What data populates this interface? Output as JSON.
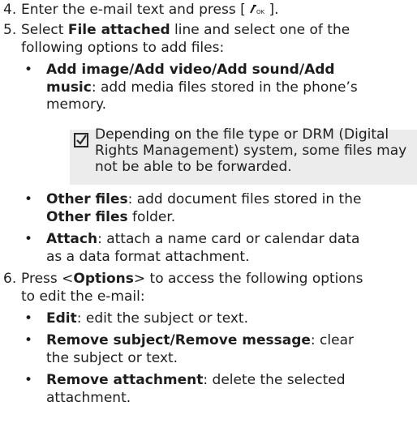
{
  "step4": {
    "num": "4.",
    "text_before": "Enter the e-mail text and press [",
    "text_after": "]."
  },
  "step5": {
    "num": "5.",
    "pre": "Select ",
    "bold": "File attached",
    "post_l1": " line and select one of the",
    "line2": "following options to add files:"
  },
  "b1": {
    "bullet": "•",
    "bold1": "Add image",
    "sep1": "/",
    "bold2": "Add video",
    "sep2": "/",
    "bold3": "Add sound",
    "sep3": "/",
    "bold4": "Add",
    "bold5": "music",
    "rest_l2": ": add media files stored in the phone’s",
    "line3": "memory."
  },
  "note": {
    "icon": "checkbox-note-icon",
    "line1": "Depending on the file type or DRM (Digital",
    "line2": "Rights Management) system, some files may",
    "line3": "not be able to be forwarded."
  },
  "b2": {
    "bullet": "•",
    "bold1": "Other files",
    "rest1": ": add document files stored in the",
    "bold2": "Other files",
    "rest2": " folder."
  },
  "b3": {
    "bullet": "•",
    "bold": "Attach",
    "rest": ": attach a name card or calendar data",
    "line2": "as a data format attachment."
  },
  "step6": {
    "num": "6.",
    "pre": "Press <",
    "bold": "Options",
    "post": "> to access the following options",
    "line2": "to edit the e-mail:"
  },
  "b4": {
    "bullet": "•",
    "bold": "Edit",
    "rest": ": edit the subject or text."
  },
  "b5": {
    "bullet": "•",
    "bold1": "Remove subject",
    "sep": "/",
    "bold2": "Remove message",
    "rest": ": clear",
    "line2": "the subject or text."
  },
  "b6": {
    "bullet": "•",
    "bold": "Remove attachment",
    "rest": ": delete the selected",
    "line2": "attachment."
  }
}
